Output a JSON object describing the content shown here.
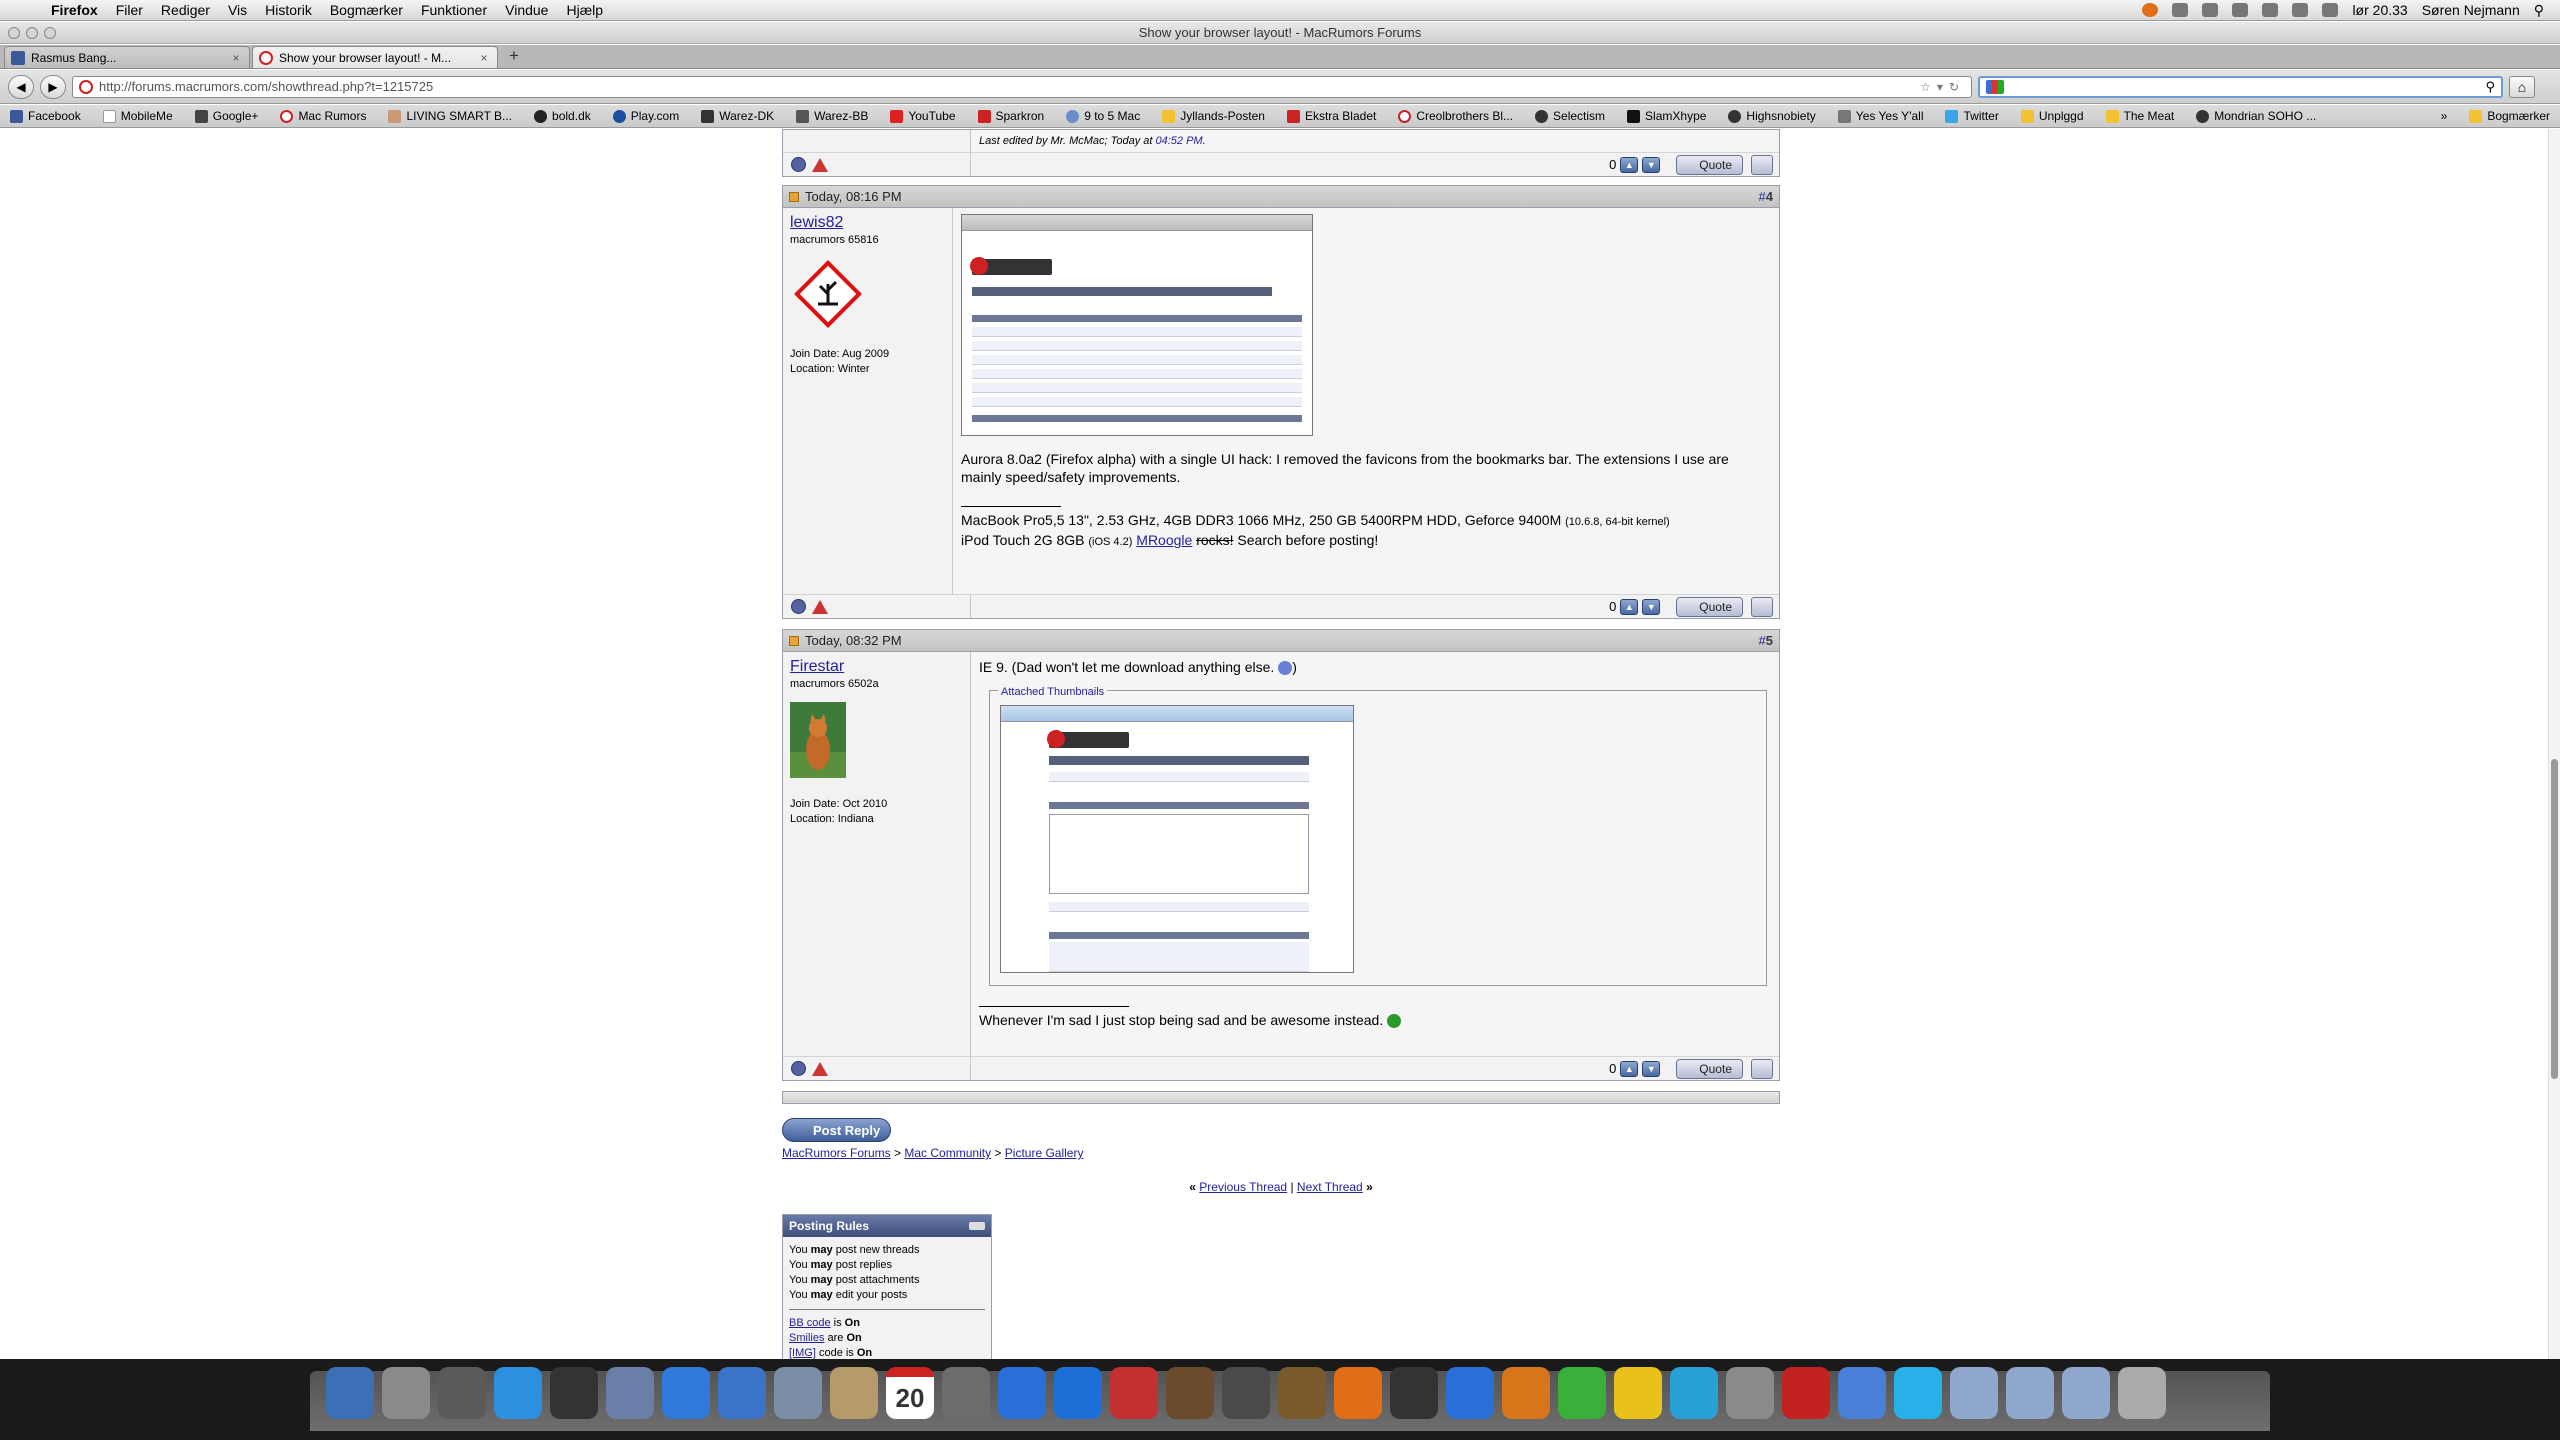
{
  "menubar": {
    "items": [
      "Firefox",
      "Filer",
      "Rediger",
      "Vis",
      "Historik",
      "Bogmærker",
      "Funktioner",
      "Vindue",
      "Hjælp"
    ],
    "clock": "lør 20.33",
    "user": "Søren Nejmann"
  },
  "window": {
    "title": "Show your browser layout! - MacRumors Forums"
  },
  "tabs": [
    {
      "label": "Rasmus Bang..."
    },
    {
      "label": "Show your browser layout! - M..."
    }
  ],
  "nav": {
    "url": "http://forums.macrumors.com/showthread.php?t=1215725",
    "search_value": ""
  },
  "bookmarks": {
    "items": [
      "Facebook",
      "MobileMe",
      "Google+",
      "Mac Rumors",
      "LIVING SMART B...",
      "bold.dk",
      "Play.com",
      "Warez-DK",
      "Warez-BB",
      "YouTube",
      "Sparkron",
      "9 to 5 Mac",
      "Jyllands-Posten",
      "Ekstra Bladet",
      "Creolbrothers Bl...",
      "Selectism",
      "SlamXhype",
      "Highsnobiety",
      "Yes Yes Y'all",
      "Twitter",
      "Unplggd",
      "The Meat",
      "Mondrian SOHO ..."
    ],
    "more": "»",
    "menu": "Bogmærker"
  },
  "prev_post": {
    "edited": "Last edited by Mr. McMac; Today at",
    "edited_time": "04:52 PM",
    "score": "0",
    "quote": "Quote"
  },
  "post4": {
    "date": "Today, 08:16 PM",
    "number": "4",
    "username": "lewis82",
    "usertitle": "macrumors 65816",
    "join": "Join Date: Aug 2009",
    "location": "Location: Winter",
    "text": "Aurora 8.0a2 (Firefox alpha) with a single UI hack: I removed the favicons from the bookmarks bar. The extensions I use are mainly speed/safety improvements.",
    "sig1": " MacBook Pro5,5 13\", 2.53 GHz, 4GB DDR3 1066 MHz, 250 GB 5400RPM HDD, Geforce 9400M",
    "sig1_small": "(10.6.8, 64-bit kernel)",
    "sig2": " iPod Touch 2G 8GB",
    "sig2_small": "(iOS 4.2)",
    "sig3_link": "MRoogle",
    "sig3_strike": "rocks!",
    "sig3_rest": " Search before posting!",
    "score": "0",
    "quote": "Quote"
  },
  "post5": {
    "date": "Today, 08:32 PM",
    "number": "5",
    "username": "Firestar",
    "usertitle": "macrumors 6502a",
    "join": "Join Date: Oct 2010",
    "location": "Location: Indiana",
    "text": "IE 9. (Dad won't let me download anything else.",
    "text_end": ")",
    "attach_legend": "Attached Thumbnails",
    "sig": "Whenever I'm sad I just stop being sad and be awesome instead.",
    "score": "0",
    "quote": "Quote"
  },
  "reply": {
    "button": "Post Reply",
    "crumbs": [
      "MacRumors Forums",
      "Mac Community",
      "Picture Gallery"
    ],
    "sep": ">",
    "prev": "Previous Thread",
    "next": "Next Thread",
    "laquo": "«",
    "raquo": "»",
    "pipe": "|"
  },
  "rules": {
    "title": "Posting Rules",
    "lines": [
      {
        "pre": "You",
        "bold": "may",
        "post": "post new threads"
      },
      {
        "pre": "You",
        "bold": "may",
        "post": "post replies"
      },
      {
        "pre": "You",
        "bold": "may",
        "post": "post attachments"
      },
      {
        "pre": "You",
        "bold": "may",
        "post": "edit your posts"
      }
    ],
    "codes": [
      {
        "link": "BB code",
        "mid": "is",
        "val": "On"
      },
      {
        "link": "Smilies",
        "mid": "are",
        "val": "On"
      },
      {
        "link": "[IMG]",
        "mid": "code is",
        "val": "On"
      }
    ]
  },
  "dock": {
    "calendar_day": "20",
    "colors": [
      "#3b6fb6",
      "#8a8a8a",
      "#5a5a5a",
      "#2d8fe0",
      "#333333",
      "#6a7fa8",
      "#2f7ad8",
      "#3a73c8",
      "#7a8fa6",
      "#b59a6a",
      "#ffffff",
      "#6c6c6c",
      "#2a6fd8",
      "#1b6fd6",
      "#c23030",
      "#6b4b2b",
      "#4a4a4a",
      "#7a5a2a",
      "#e06e16",
      "#333333",
      "#2a6fd8",
      "#d8741a",
      "#3ab03a",
      "#e8c21a",
      "#2aa0d8",
      "#8a8a8a",
      "#c22222",
      "#4a7fd8",
      "#2ab0e8",
      "#8fa7cc",
      "#8fa7cc",
      "#8fa7cc",
      "#aaaaaa"
    ]
  }
}
